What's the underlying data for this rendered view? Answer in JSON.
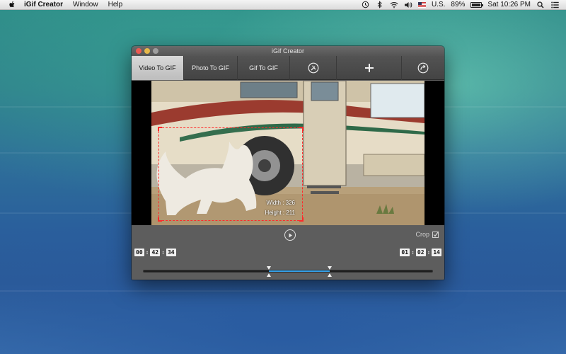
{
  "menubar": {
    "app_name": "iGif Creator",
    "items": [
      "Window",
      "Help"
    ],
    "input_source": "U.S.",
    "battery": "89%",
    "battery_level": 0.89,
    "clock": "Sat 10:26 PM"
  },
  "window": {
    "title": "iGif Creator",
    "tabs": [
      {
        "label": "Video To GIF",
        "active": true
      },
      {
        "label": "Photo To GIF",
        "active": false
      },
      {
        "label": "Gif To GIF",
        "active": false
      }
    ],
    "tools": [
      "tools-icon",
      "add-icon",
      "export-icon"
    ]
  },
  "video": {
    "crop_width": "Width : 326",
    "crop_height": "Height : 211"
  },
  "controls": {
    "crop_label": "Crop",
    "crop_checked": true,
    "start_time": {
      "h": "00",
      "m": "42",
      "s": "34"
    },
    "end_time": {
      "h": "01",
      "m": "02",
      "s": "14"
    },
    "range_start": 0.435,
    "range_end": 0.645
  },
  "colors": {
    "accent": "#34a0e8",
    "crop_border": "#ff2a2a"
  }
}
